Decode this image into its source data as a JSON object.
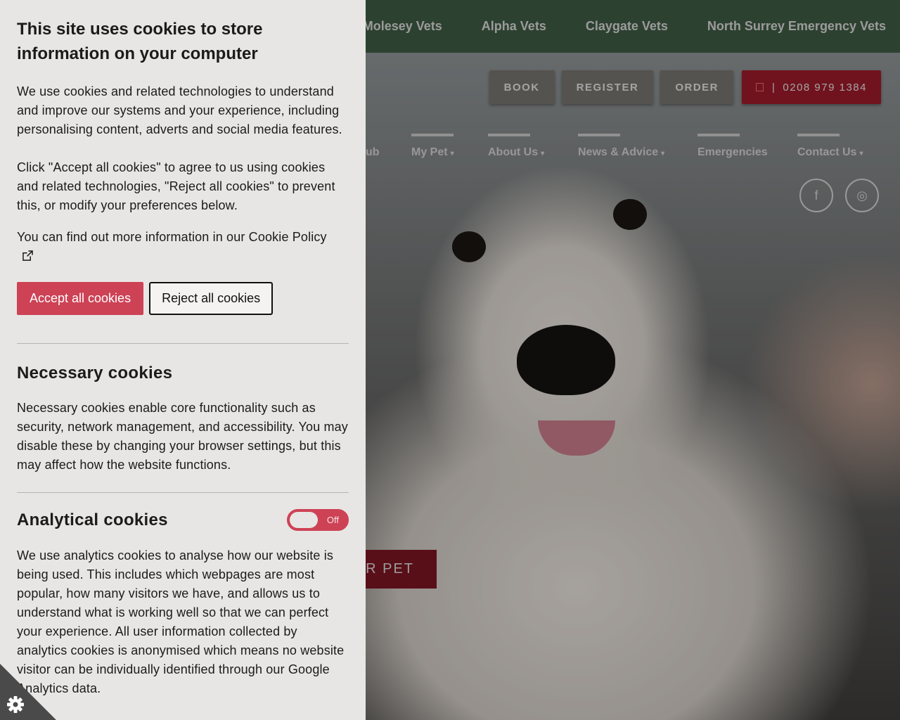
{
  "site": {
    "topbar_links": [
      "Molesey Vets",
      "Alpha Vets",
      "Claygate Vets",
      "North Surrey Emergency Vets"
    ],
    "actions": {
      "book": "BOOK",
      "register": "REGISTER",
      "order": "ORDER",
      "phone_sep": "|",
      "phone": "0208 979 1384"
    },
    "nav": {
      "partial": "ub",
      "my_pet": "My Pet",
      "about_us": "About Us",
      "news_advice": "News & Advice",
      "emergencies": "Emergencies",
      "contact_us": "Contact Us",
      "caret": "▾"
    },
    "social": {
      "facebook": "f",
      "instagram": "◎"
    },
    "hero_cta": "UR PET"
  },
  "cookie_panel": {
    "title": "This site uses cookies to store information on your computer",
    "intro": "We use cookies and related technologies to understand and improve our systems and your experience, including personalising content, adverts and social media features.",
    "instructions": "Click \"Accept all cookies\" to agree to us using cookies and related technologies, \"Reject all cookies\" to prevent this, or modify your preferences below.",
    "policy_text": "You can find out more information in our Cookie Policy",
    "accept_label": "Accept all cookies",
    "reject_label": "Reject all cookies",
    "necessary": {
      "title": "Necessary cookies",
      "description": "Necessary cookies enable core functionality such as security, network management, and accessibility. You may disable these by changing your browser settings, but this may affect how the website functions."
    },
    "analytical": {
      "title": "Analytical cookies",
      "toggle_label": "Off",
      "description": "We use analytics cookies to analyse how our website is being used. This includes which webpages are most popular, how many visitors we have, and allows us to understand what is working well so that we can perfect your experience. All user information collected by analytics cookies is anonymised which means no website visitor can be individually identified through our Google Analytics data."
    }
  },
  "colors": {
    "accent": "#cd4255",
    "topbar": "#3f5a43",
    "panel_bg": "#e8e6e4",
    "phone_btn": "#9b1b2a"
  },
  "icons": {
    "corner": "cog-icon",
    "policy_link": "external-link-icon"
  }
}
